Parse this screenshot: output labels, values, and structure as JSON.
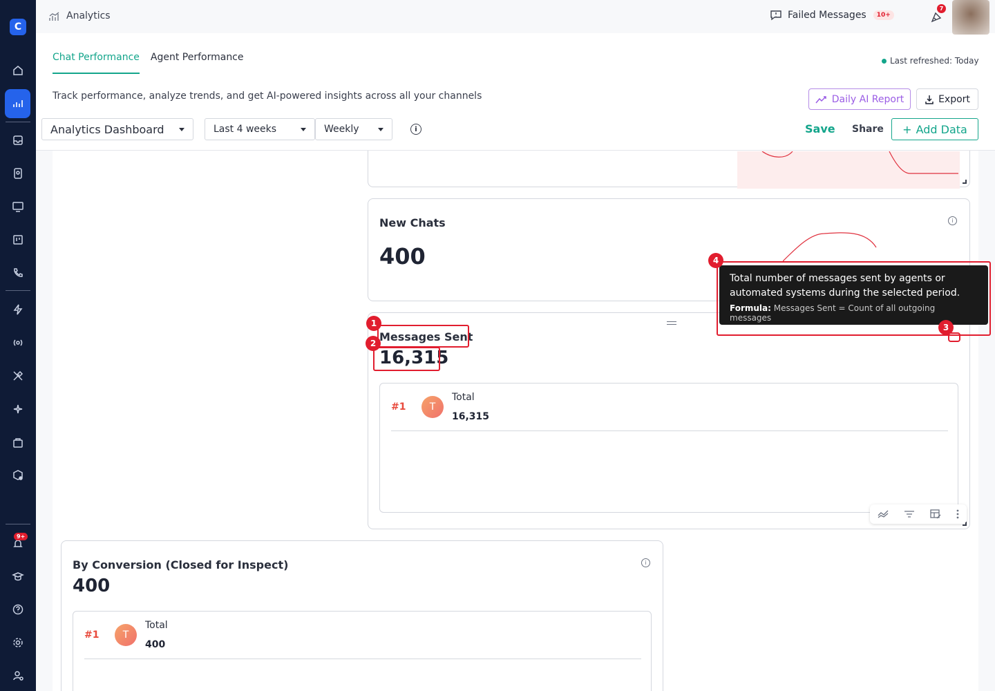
{
  "app": {
    "section_title": "Analytics"
  },
  "header": {
    "failed_messages_label": "Failed Messages",
    "failed_messages_badge": "10+",
    "notification_badge": "7"
  },
  "sidebar": {
    "alerts_badge": "9+"
  },
  "tabs": [
    {
      "label": "Chat Performance",
      "active": true
    },
    {
      "label": "Agent Performance",
      "active": false
    }
  ],
  "status": {
    "last_refreshed": "Last refreshed: Today"
  },
  "page": {
    "subtitle": "Track performance, analyze trends, and get AI-powered insights across all your channels",
    "daily_ai_report_label": "Daily AI Report",
    "export_label": "Export"
  },
  "filters": {
    "dashboard": "Analytics Dashboard",
    "range": "Last 4 weeks",
    "granularity": "Weekly"
  },
  "actions": {
    "save": "Save",
    "share": "Share",
    "add_data": "Add Data"
  },
  "cards": {
    "new_chats": {
      "title": "New Chats",
      "value": "400"
    },
    "messages_sent": {
      "title": "Messages Sent",
      "value": "16,315",
      "rows": [
        {
          "rank": "#1",
          "avatar": "T",
          "name": "Total",
          "value": "16,315"
        }
      ]
    },
    "by_conversion": {
      "title": "By Conversion (Closed for Inspect)",
      "value": "400",
      "rows": [
        {
          "rank": "#1",
          "avatar": "T",
          "name": "Total",
          "value": "400"
        }
      ]
    }
  },
  "tooltip": {
    "text": "Total number of messages sent by agents or automated systems during the selected period.",
    "formula_label": "Formula:",
    "formula": "Messages Sent = Count of all outgoing messages"
  },
  "markers": [
    "1",
    "2",
    "3",
    "4"
  ],
  "colors": {
    "accent": "#13a58b",
    "ai_purple": "#9b5de5",
    "marker_red": "#e11d2e",
    "sidebar": "#0f1b36"
  }
}
